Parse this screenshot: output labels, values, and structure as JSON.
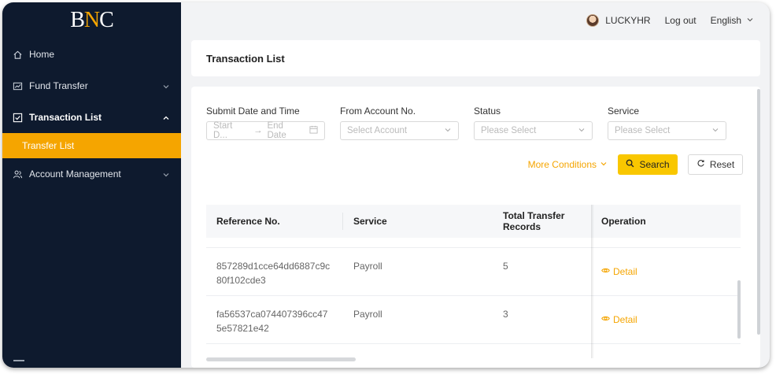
{
  "brand": {
    "logo_part1": "B",
    "logo_accent": "N",
    "logo_part2": "C"
  },
  "header": {
    "username": "LUCKYHR",
    "logout": "Log out",
    "language": "English"
  },
  "sidebar": {
    "items": [
      {
        "label": "Home",
        "icon": "home-icon"
      },
      {
        "label": "Fund Transfer",
        "icon": "chart-icon"
      },
      {
        "label": "Transaction List",
        "icon": "checkbox-icon"
      },
      {
        "label": "Account Management",
        "icon": "users-icon"
      }
    ],
    "subitem": {
      "label": "Transfer List"
    }
  },
  "page": {
    "title": "Transaction List"
  },
  "filters": {
    "date": {
      "label": "Submit Date and Time",
      "start_placeholder": "Start D...",
      "end_placeholder": "End Date"
    },
    "account": {
      "label": "From Account No.",
      "placeholder": "Select Account"
    },
    "status": {
      "label": "Status",
      "placeholder": "Please Select"
    },
    "service": {
      "label": "Service",
      "placeholder": "Please Select"
    }
  },
  "actions": {
    "more": "More Conditions",
    "search": "Search",
    "reset": "Reset"
  },
  "table": {
    "columns": [
      "Reference No.",
      "Service",
      "Total Transfer Records",
      "Operation"
    ],
    "rows": [
      {
        "reference": "857289d1cce64dd6887c9c80f102cde3",
        "service": "Payroll",
        "records": "5",
        "operation": "Detail"
      },
      {
        "reference": "fa56537ca074407396cc475e57821e42",
        "service": "Payroll",
        "records": "3",
        "operation": "Detail"
      }
    ]
  },
  "colors": {
    "sidebar_bg": "#0e1a2e",
    "accent": "#f5a500",
    "search_btn": "#f9c700"
  }
}
